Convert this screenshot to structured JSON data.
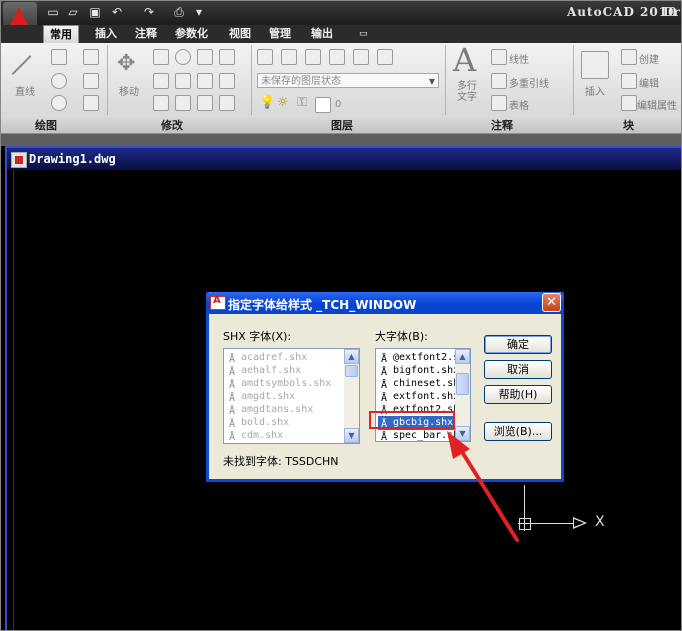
{
  "app": {
    "title": "AutoCAD 2010",
    "title_overflow": "Dr",
    "colors": {
      "accent": "#0b49d6",
      "selection": "#316ac5",
      "annotation": "#e02222"
    }
  },
  "qat": {
    "icons": [
      "new-icon",
      "open-icon",
      "save-icon",
      "undo-icon",
      "redo-icon",
      "plot-icon"
    ]
  },
  "ribbon": {
    "tabs": [
      "常用",
      "插入",
      "注释",
      "参数化",
      "视图",
      "管理",
      "输出"
    ],
    "active_tab": "常用",
    "labels": {
      "line": "直线",
      "move": "移动",
      "layer_state": "未保存的图层状态",
      "layer_value": "0",
      "text": "多行\n文字",
      "dimension": "线性",
      "multileader": "多重引线",
      "table": "表格",
      "insert": "插入",
      "create": "创建",
      "edit": "编辑",
      "edit_attr": "编辑属性"
    },
    "groups": [
      "绘图",
      "修改",
      "图层",
      "注释",
      "块"
    ]
  },
  "drawing": {
    "title": "Drawing1.dwg",
    "ucs_x_label": "X"
  },
  "dialog": {
    "title": "指定字体给样式 _TCH_WINDOW",
    "shx_label": "SHX 字体(X):",
    "bigfont_label": "大字体(B):",
    "shx_fonts": [
      "acadref.shx",
      "aehalf.shx",
      "amdtsymbols.shx",
      "amgdt.shx",
      "amgdtans.shx",
      "bold.shx",
      "cdm.shx"
    ],
    "big_fonts": [
      "@extfont2.s",
      "bigfont.shx",
      "chineset.sh",
      "extfont.shx",
      "extfont2.sh",
      "gbcbig.shx",
      "spec_bar.sh"
    ],
    "selected_big_font": "gbcbig.shx",
    "status": "未找到字体: TSSDCHN",
    "buttons": {
      "ok": "确定",
      "cancel": "取消",
      "help": "帮助(H)",
      "browse": "浏览(B)..."
    },
    "close_glyph": "✕"
  }
}
